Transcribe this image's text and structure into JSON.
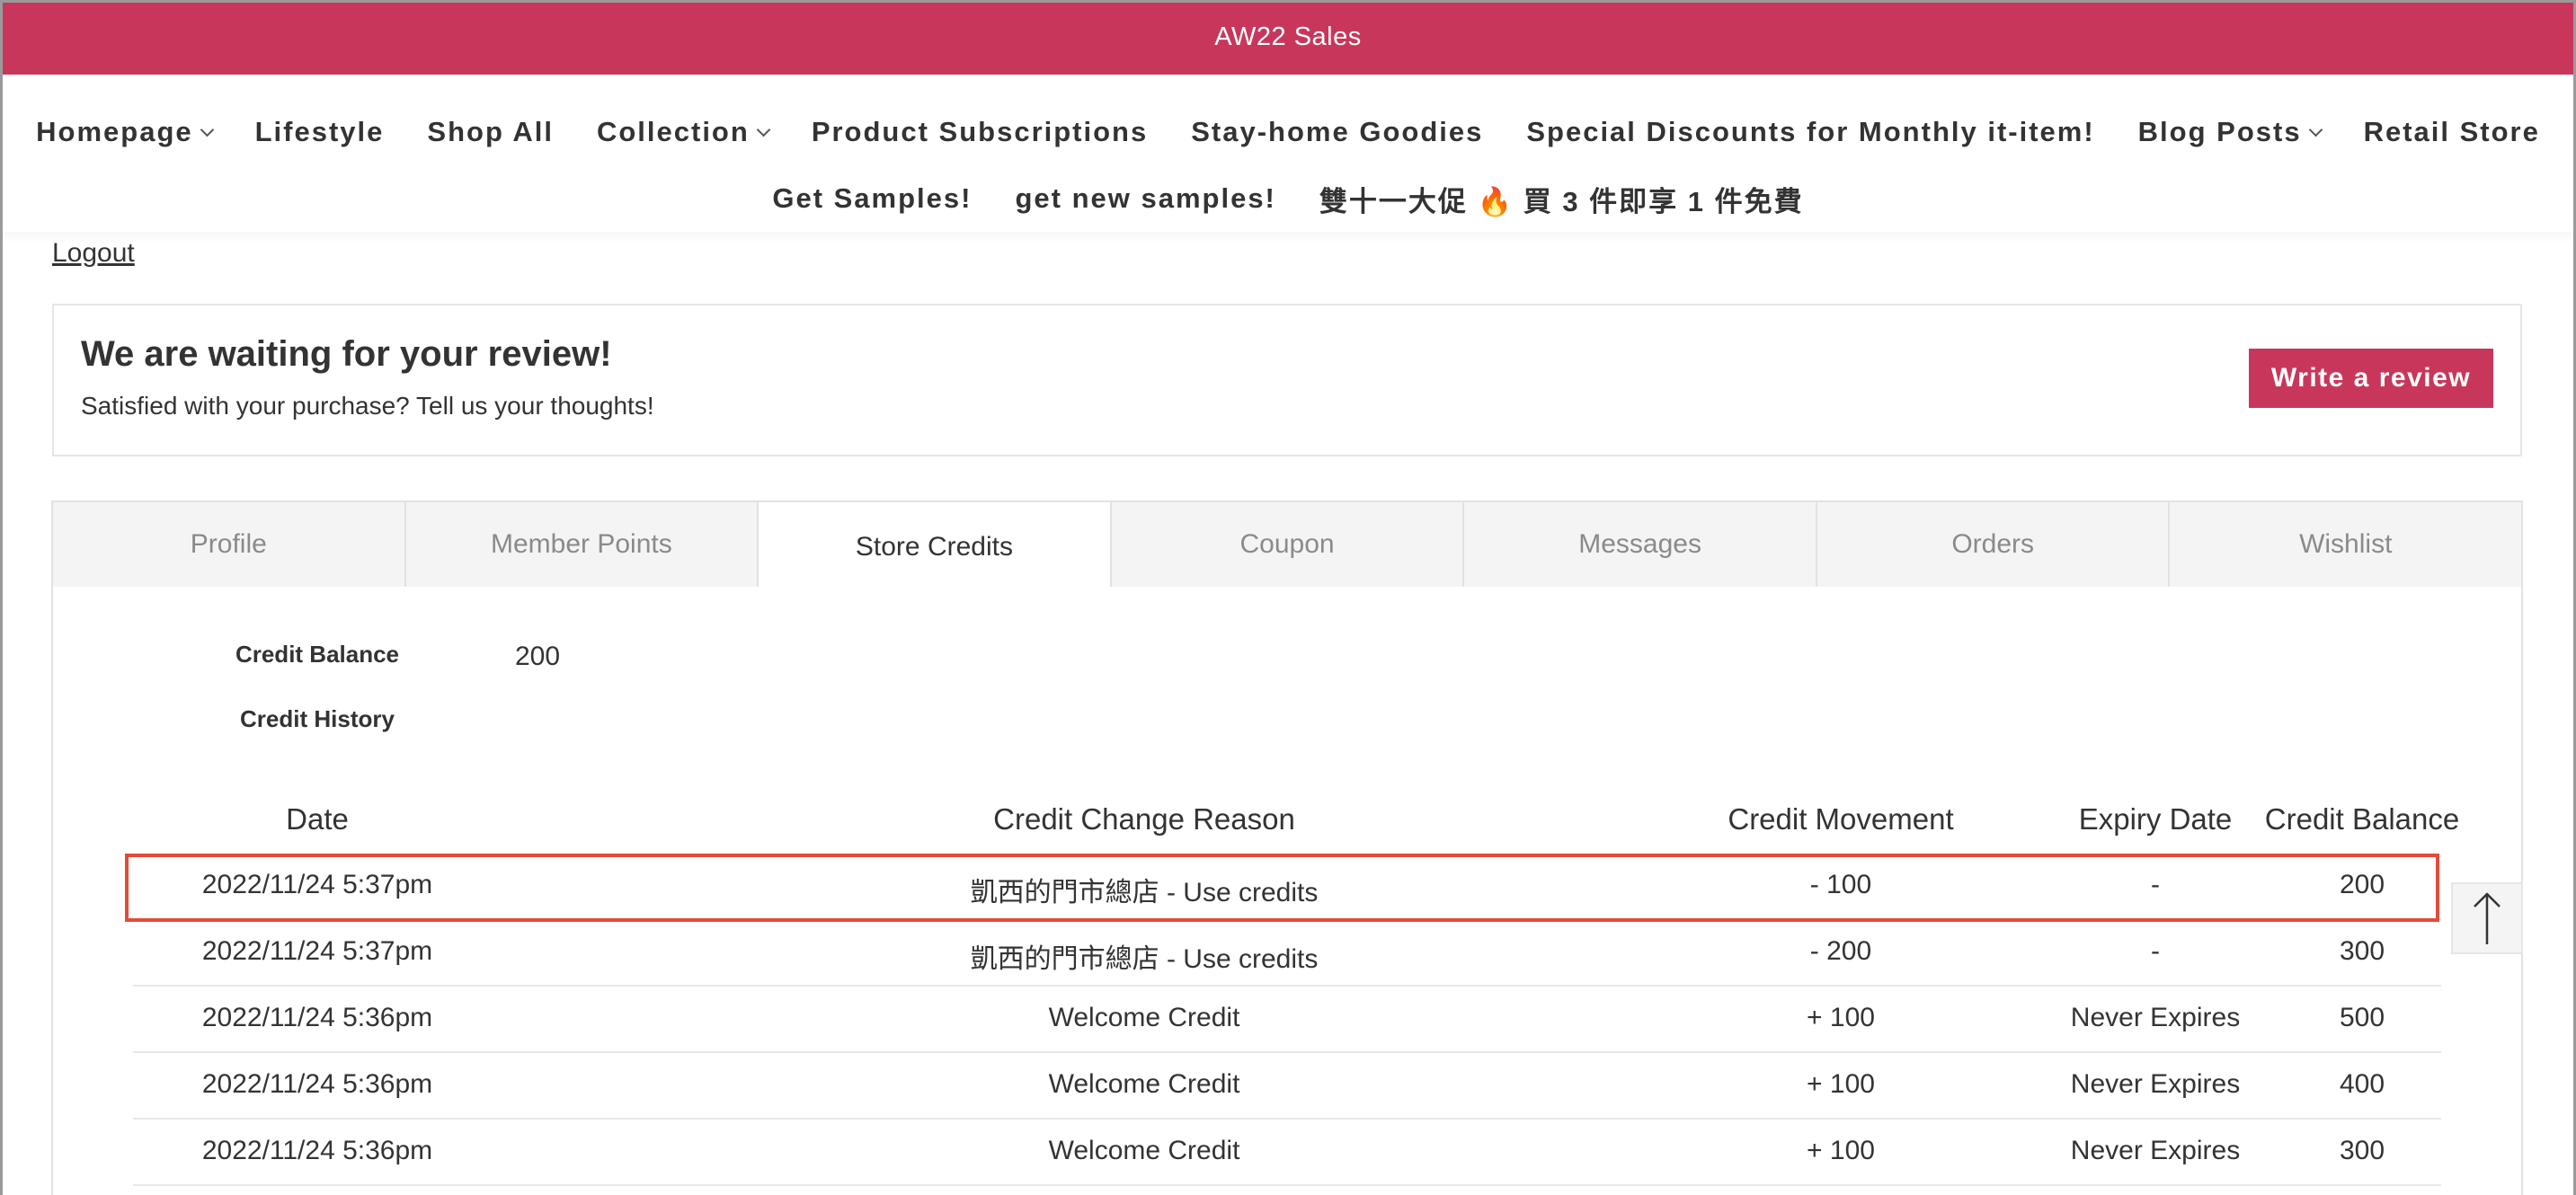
{
  "announcement": {
    "text": "AW22 Sales"
  },
  "nav": {
    "row1": [
      {
        "label": "Homepage",
        "dropdown": true
      },
      {
        "label": "Lifestyle",
        "dropdown": false
      },
      {
        "label": "Shop All",
        "dropdown": false
      },
      {
        "label": "Collection",
        "dropdown": true
      },
      {
        "label": "Product Subscriptions",
        "dropdown": false
      },
      {
        "label": "Stay-home Goodies",
        "dropdown": false
      },
      {
        "label": "Special Discounts for Monthly it-item!",
        "dropdown": false
      },
      {
        "label": "Blog Posts",
        "dropdown": true
      },
      {
        "label": "Retail Store",
        "dropdown": false
      }
    ],
    "row2": [
      {
        "label": "Get Samples!",
        "dropdown": false
      },
      {
        "label": "get new samples!",
        "dropdown": false
      },
      {
        "label": "雙十一大促 🔥 買 3 件即享 1 件免費",
        "dropdown": false
      }
    ]
  },
  "account": {
    "logout_label": "Logout"
  },
  "review": {
    "title": "We are waiting for your review!",
    "subtitle": "Satisfied with your purchase? Tell us your thoughts!",
    "button_label": "Write a review"
  },
  "tabs": [
    {
      "label": "Profile",
      "active": false
    },
    {
      "label": "Member Points",
      "active": false
    },
    {
      "label": "Store Credits",
      "active": true
    },
    {
      "label": "Coupon",
      "active": false
    },
    {
      "label": "Messages",
      "active": false
    },
    {
      "label": "Orders",
      "active": false
    },
    {
      "label": "Wishlist",
      "active": false
    }
  ],
  "credits": {
    "balance_label": "Credit Balance",
    "balance_value": "200",
    "history_label": "Credit History",
    "columns": [
      "Date",
      "Credit Change Reason",
      "Credit Movement",
      "Expiry Date",
      "Credit Balance"
    ],
    "rows": [
      {
        "date": "2022/11/24 5:37pm",
        "reason": "凱西的門市總店 - Use credits",
        "movement": "- 100",
        "expiry": "-",
        "balance": "200",
        "highlighted": true
      },
      {
        "date": "2022/11/24 5:37pm",
        "reason": "凱西的門市總店 - Use credits",
        "movement": "- 200",
        "expiry": "-",
        "balance": "300",
        "highlighted": false
      },
      {
        "date": "2022/11/24 5:36pm",
        "reason": "Welcome Credit",
        "movement": "+ 100",
        "expiry": "Never Expires",
        "balance": "500",
        "highlighted": false
      },
      {
        "date": "2022/11/24 5:36pm",
        "reason": "Welcome Credit",
        "movement": "+ 100",
        "expiry": "Never Expires",
        "balance": "400",
        "highlighted": false
      },
      {
        "date": "2022/11/24 5:36pm",
        "reason": "Welcome Credit",
        "movement": "+ 100",
        "expiry": "Never Expires",
        "balance": "300",
        "highlighted": false
      }
    ]
  },
  "colors": {
    "brand": "#c8375b",
    "highlight": "#e24b3a",
    "tab_inactive_bg": "#f4f4f4"
  },
  "icons": {
    "back_to_top": "arrow-up-icon",
    "dropdown": "chevron-down-icon"
  }
}
